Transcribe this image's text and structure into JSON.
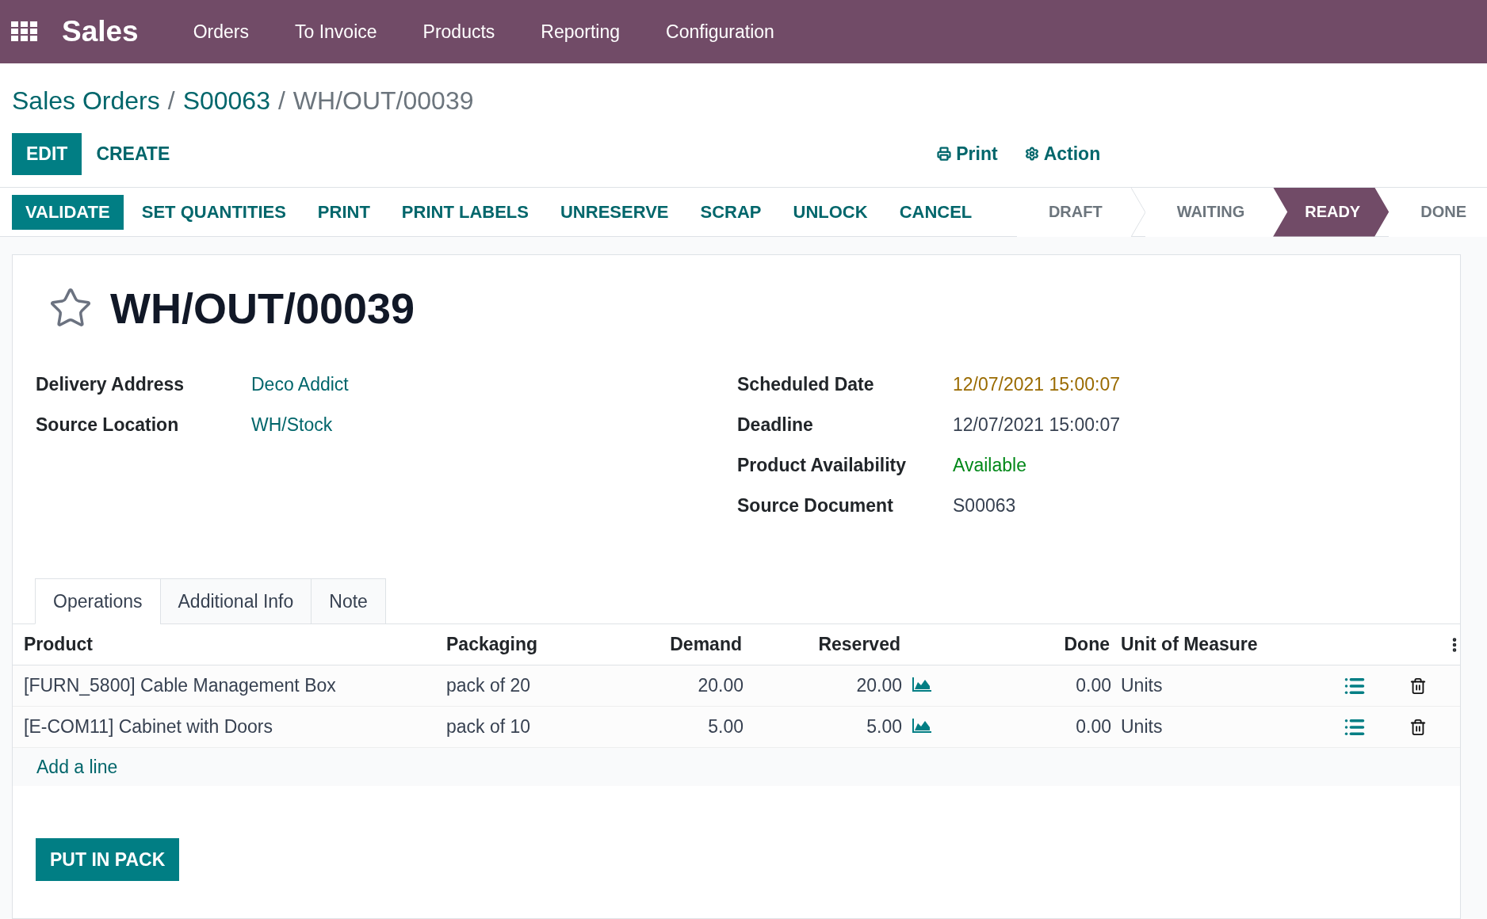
{
  "navbar": {
    "app": "Sales",
    "menu": [
      "Orders",
      "To Invoice",
      "Products",
      "Reporting",
      "Configuration"
    ]
  },
  "breadcrumb": [
    {
      "label": "Sales Orders",
      "current": false
    },
    {
      "separator": "/",
      "label": "S00063",
      "current": false
    },
    {
      "separator": "/",
      "label": "WH/OUT/00039",
      "current": true
    }
  ],
  "control_buttons": [
    {
      "label": "EDIT",
      "kind": "primary"
    },
    {
      "label": "CREATE",
      "kind": "link"
    }
  ],
  "actions": [
    {
      "label": "Print",
      "kind": "print"
    },
    {
      "label": "Action",
      "kind": "gear"
    }
  ],
  "header_buttons": [
    {
      "label": "VALIDATE",
      "kind": "primary"
    },
    {
      "label": "SET QUANTITIES",
      "kind": "link"
    },
    {
      "label": "PRINT",
      "kind": "link"
    },
    {
      "label": "PRINT LABELS",
      "kind": "link"
    },
    {
      "label": "UNRESERVE",
      "kind": "link"
    },
    {
      "label": "SCRAP",
      "kind": "link"
    },
    {
      "label": "UNLOCK",
      "kind": "link"
    },
    {
      "label": "CANCEL",
      "kind": "link"
    }
  ],
  "stages": [
    {
      "label": "DRAFT",
      "selected": false
    },
    {
      "label": "WAITING",
      "selected": false
    },
    {
      "label": "READY",
      "selected": true
    },
    {
      "label": "DONE",
      "selected": false
    }
  ],
  "record": {
    "title": "WH/OUT/00039",
    "starred": false
  },
  "fields_left": [
    {
      "label": "Delivery Address",
      "value": "Deco Addict",
      "kind": "link"
    },
    {
      "label": "Source Location",
      "value": "WH/Stock",
      "kind": "link"
    }
  ],
  "fields_right": [
    {
      "label": "Scheduled Date",
      "value": "12/07/2021 15:00:07",
      "kind": "warning"
    },
    {
      "label": "Deadline",
      "value": "12/07/2021 15:00:07",
      "kind": "plain"
    },
    {
      "label": "Product Availability",
      "value": "Available",
      "kind": "success"
    },
    {
      "label": "Source Document",
      "value": "S00063",
      "kind": "plain"
    }
  ],
  "tabs": [
    {
      "label": "Operations",
      "selected": true
    },
    {
      "label": "Additional Info",
      "selected": false
    },
    {
      "label": "Note",
      "selected": false
    }
  ],
  "table": {
    "columns": [
      "Product",
      "Packaging",
      "Demand",
      "Reserved",
      "Done",
      "Unit of Measure"
    ],
    "rows": [
      {
        "product": "[FURN_5800] Cable Management Box",
        "packaging": "pack of 20",
        "demand": "20.00",
        "reserved": "20.00",
        "done": "0.00",
        "uom": "Units"
      },
      {
        "product": "[E-COM11] Cabinet with Doors",
        "packaging": "pack of 10",
        "demand": "5.00",
        "reserved": "5.00",
        "done": "0.00",
        "uom": "Units"
      }
    ],
    "add_line": "Add a line"
  },
  "footer_button": "PUT IN PACK"
}
